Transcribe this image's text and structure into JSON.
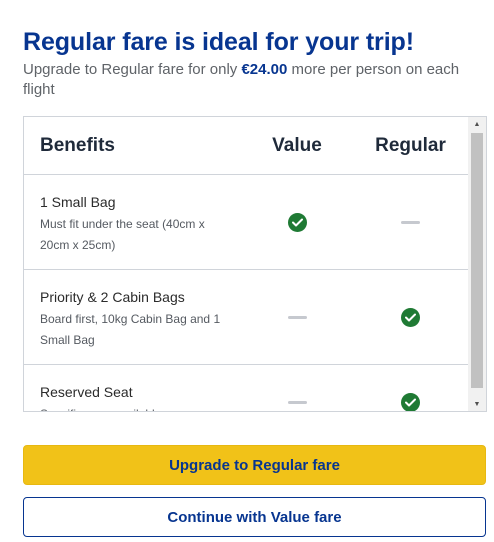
{
  "header": {
    "title": "Regular fare is ideal for your trip!",
    "subtitle_before": "Upgrade to Regular fare for only ",
    "subtitle_price": "€24.00",
    "subtitle_after": " more per person on each flight"
  },
  "table": {
    "columns": [
      "Benefits",
      "Value",
      "Regular"
    ],
    "rows": [
      {
        "title": "1 Small Bag",
        "description": "Must fit under the seat (40cm x 20cm x 25cm)",
        "value": "check",
        "regular": "dash"
      },
      {
        "title": "Priority & 2 Cabin Bags",
        "description": "Board first, 10kg Cabin Bag and 1 Small Bag",
        "value": "dash",
        "regular": "check"
      },
      {
        "title": "Reserved Seat",
        "description": "Specific rows available",
        "value": "dash",
        "regular": "check"
      }
    ]
  },
  "buttons": {
    "upgrade_label": "Upgrade to Regular fare",
    "continue_label": "Continue with Value fare"
  },
  "colors": {
    "brand_blue": "#073590",
    "accent_yellow": "#f1c218",
    "check_green": "#1f7a34",
    "dash_grey": "#c6c9cf"
  },
  "icons": {
    "included": "check-circle-icon",
    "not_included": "dash-icon",
    "scroll_up": "triangle-up-icon",
    "scroll_down": "triangle-down-icon"
  }
}
